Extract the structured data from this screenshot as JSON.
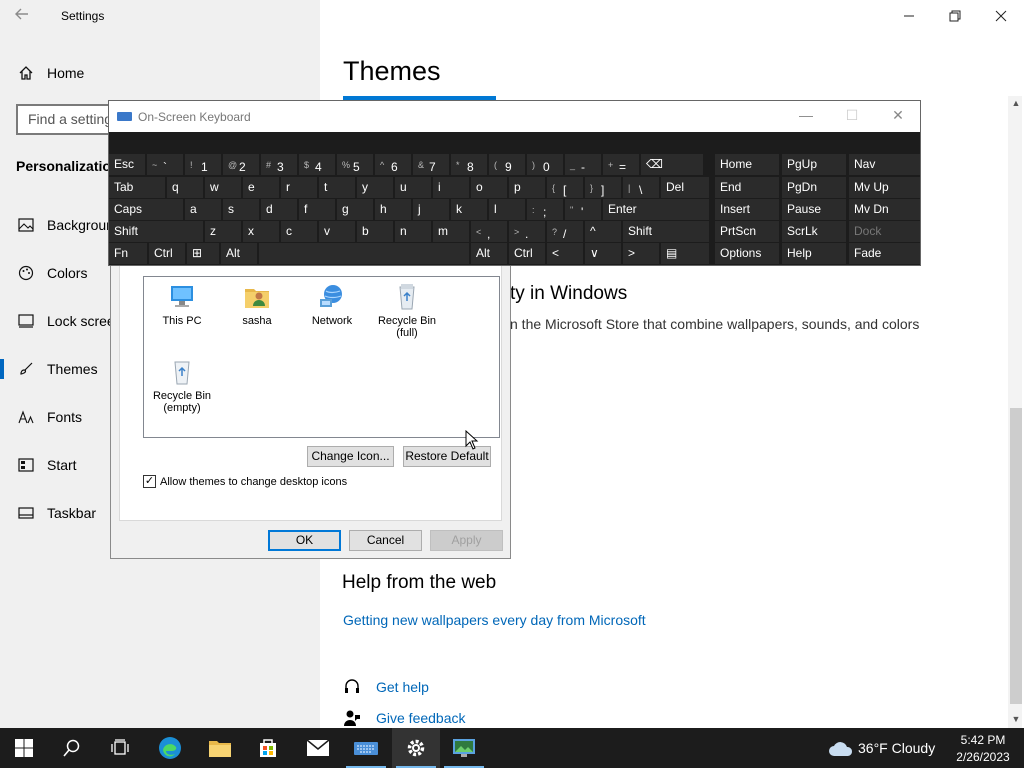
{
  "settings": {
    "window_title": "Settings",
    "home_label": "Home",
    "search_placeholder": "Find a setting",
    "section_title": "Personalization",
    "nav_items": [
      {
        "label": "Background"
      },
      {
        "label": "Colors"
      },
      {
        "label": "Lock screen"
      },
      {
        "label": "Themes"
      },
      {
        "label": "Fonts"
      },
      {
        "label": "Start"
      },
      {
        "label": "Taskbar"
      }
    ],
    "selected_nav": "Themes",
    "page_title": "Themes",
    "section_heading_partial": "ty in Windows",
    "section_text_partial": "n the Microsoft Store that combine wallpapers, sounds, and colors",
    "help_heading": "Help from the web",
    "help_link": "Getting new wallpapers every day from Microsoft",
    "get_help": "Get help",
    "give_feedback": "Give feedback"
  },
  "dialog": {
    "icons": [
      {
        "label": "This PC",
        "icon": "computer-icon"
      },
      {
        "label": "sasha",
        "icon": "user-folder-icon"
      },
      {
        "label": "Network",
        "icon": "network-icon"
      },
      {
        "label": "Recycle Bin\n(full)",
        "icon": "recycle-bin-full-icon"
      },
      {
        "label": "Recycle Bin\n(empty)",
        "icon": "recycle-bin-empty-icon"
      }
    ],
    "change_icon_label": "Change Icon...",
    "restore_default_label": "Restore Default",
    "allow_themes_label": "Allow themes to change desktop icons",
    "allow_themes_checked": true,
    "ok_label": "OK",
    "cancel_label": "Cancel",
    "apply_label": "Apply"
  },
  "osk": {
    "title": "On-Screen Keyboard",
    "row1": [
      "Esc",
      "~",
      "`",
      "!",
      "1",
      "@",
      "2",
      "#",
      "3",
      "$",
      "4",
      "%",
      "5",
      "^",
      "6",
      "&",
      "7",
      "*",
      "8",
      "(",
      "9",
      ")",
      "0",
      "_",
      "-",
      "+",
      "=",
      "⌫"
    ],
    "row2": [
      "Tab",
      "q",
      "w",
      "e",
      "r",
      "t",
      "y",
      "u",
      "i",
      "o",
      "p",
      "{",
      "[",
      "}",
      "]",
      "|",
      "\\",
      "Del"
    ],
    "row3": [
      "Caps",
      "a",
      "s",
      "d",
      "f",
      "g",
      "h",
      "j",
      "k",
      "l",
      ":",
      ";",
      "\"",
      "'",
      "Enter"
    ],
    "row4": [
      "Shift",
      "z",
      "x",
      "c",
      "v",
      "b",
      "n",
      "m",
      "<",
      ",",
      ">",
      ".",
      "?",
      "/",
      "^",
      "Shift"
    ],
    "row5": [
      "Fn",
      "Ctrl",
      "⊞",
      "Alt",
      "Alt",
      "Ctrl",
      "<",
      "∨",
      ">",
      "▤"
    ],
    "nav_keys": [
      [
        "Home",
        "PgUp",
        "Nav"
      ],
      [
        "End",
        "PgDn",
        "Mv Up"
      ],
      [
        "Insert",
        "Pause",
        "Mv Dn"
      ],
      [
        "PrtScn",
        "ScrLk",
        "Dock"
      ],
      [
        "Options",
        "Help",
        "Fade"
      ]
    ]
  },
  "taskbar": {
    "weather": "36°F  Cloudy",
    "time": "5:42 PM",
    "date": "2/26/2023"
  }
}
